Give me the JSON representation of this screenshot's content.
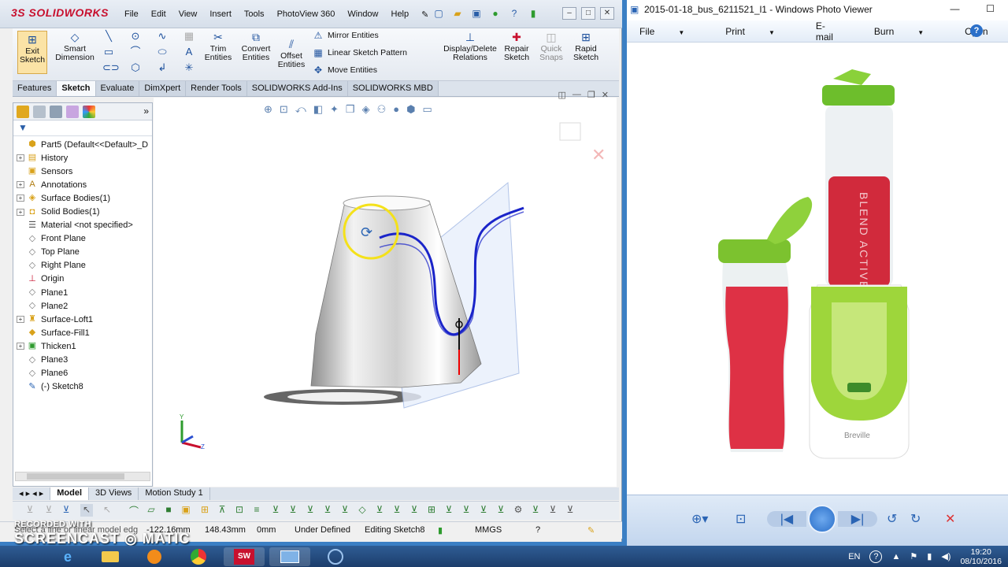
{
  "solidworks": {
    "logo": "SOLIDWORKS",
    "menu": [
      "File",
      "Edit",
      "View",
      "Insert",
      "Tools",
      "PhotoView 360",
      "Window",
      "Help"
    ],
    "ribbon": {
      "exit_sketch": "Exit Sketch",
      "smart_dimension": "Smart Dimension",
      "trim_entities": "Trim Entities",
      "convert_entities": "Convert Entities",
      "offset_entities": "Offset Entities",
      "mirror_entities": "Mirror Entities",
      "linear_sketch_pattern": "Linear Sketch Pattern",
      "move_entities": "Move Entities",
      "display_delete_relations": "Display/Delete Relations",
      "repair_sketch": "Repair Sketch",
      "quick_snaps": "Quick Snaps",
      "rapid_sketch": "Rapid Sketch"
    },
    "command_tabs": [
      "Features",
      "Sketch",
      "Evaluate",
      "DimXpert",
      "Render Tools",
      "SOLIDWORKS Add-Ins",
      "SOLIDWORKS MBD"
    ],
    "active_tab": "Sketch",
    "tree": [
      {
        "label": "Part5  (Default<<Default>_D",
        "icon": "part-icon",
        "exp": false
      },
      {
        "label": "History",
        "icon": "history-icon",
        "exp": true
      },
      {
        "label": "Sensors",
        "icon": "sensor-icon",
        "exp": false
      },
      {
        "label": "Annotations",
        "icon": "annotation-icon",
        "exp": true
      },
      {
        "label": "Surface Bodies(1)",
        "icon": "surface-bodies-icon",
        "exp": true
      },
      {
        "label": "Solid Bodies(1)",
        "icon": "solid-bodies-icon",
        "exp": true
      },
      {
        "label": "Material <not specified>",
        "icon": "material-icon",
        "exp": false
      },
      {
        "label": "Front Plane",
        "icon": "plane-icon",
        "exp": false
      },
      {
        "label": "Top Plane",
        "icon": "plane-icon",
        "exp": false
      },
      {
        "label": "Right Plane",
        "icon": "plane-icon",
        "exp": false
      },
      {
        "label": "Origin",
        "icon": "origin-icon",
        "exp": false
      },
      {
        "label": "Plane1",
        "icon": "plane-icon",
        "exp": false
      },
      {
        "label": "Plane2",
        "icon": "plane-icon",
        "exp": false
      },
      {
        "label": "Surface-Loft1",
        "icon": "loft-icon",
        "exp": true
      },
      {
        "label": "Surface-Fill1",
        "icon": "fill-icon",
        "exp": false
      },
      {
        "label": "Thicken1",
        "icon": "thicken-icon",
        "exp": true
      },
      {
        "label": "Plane3",
        "icon": "plane-icon",
        "exp": false
      },
      {
        "label": "Plane6",
        "icon": "plane-icon",
        "exp": false
      },
      {
        "label": "(-) Sketch8",
        "icon": "sketch-icon",
        "exp": false
      }
    ],
    "bottom_tabs": [
      "Model",
      "3D Views",
      "Motion Study 1"
    ],
    "status": {
      "hint": "Select a line or linear model edg",
      "x": "-122.16mm",
      "y": "148.43mm",
      "z": "0mm",
      "definition": "Under Defined",
      "editing": "Editing Sketch8",
      "units": "MMGS"
    }
  },
  "watermark": {
    "line1": "RECORDED WITH",
    "line2": "SCREENCAST",
    "line3": "MATIC"
  },
  "photoviewer": {
    "title": "2015-01-18_bus_6211521_l1 - Windows Photo Viewer",
    "menu": [
      "File",
      "Print",
      "E-mail",
      "Burn",
      "Open"
    ],
    "product_text": "BLEND ACTIVE",
    "brand": "Breville"
  },
  "taskbar": {
    "lang": "EN",
    "time": "19:20",
    "date": "08/10/2016"
  }
}
